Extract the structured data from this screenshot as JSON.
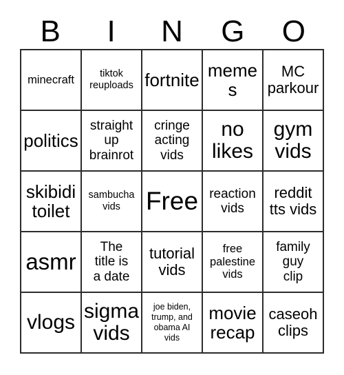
{
  "card": {
    "title_letters": [
      "B",
      "I",
      "N",
      "G",
      "O"
    ],
    "background_color": "#ffffff",
    "border_color": "#2b2b2b",
    "text_color": "#000000",
    "grid_size": "5x5",
    "free_space_label": "Free",
    "free_space_position": "row3-col3"
  },
  "rows": [
    {
      "cells": [
        {
          "text": "minecraft",
          "size": "m"
        },
        {
          "text": "tiktok\nreuploads",
          "size": "s"
        },
        {
          "text": "fortnite",
          "size": "xxl"
        },
        {
          "text": "memes",
          "size": "xxl"
        },
        {
          "text": "MC\nparkour",
          "size": "xl"
        }
      ]
    },
    {
      "cells": [
        {
          "text": "politics",
          "size": "xxl"
        },
        {
          "text": "straight\nup\nbrainrot",
          "size": "l"
        },
        {
          "text": "cringe\nacting\nvids",
          "size": "l"
        },
        {
          "text": "no\nlikes",
          "size": "3xl"
        },
        {
          "text": "gym\nvids",
          "size": "3xl"
        }
      ]
    },
    {
      "cells": [
        {
          "text": "skibidi\ntoilet",
          "size": "xxl"
        },
        {
          "text": "sambucha\nvids",
          "size": "s"
        },
        {
          "text": "Free",
          "size": "free"
        },
        {
          "text": "reaction\nvids",
          "size": "l"
        },
        {
          "text": "reddit\ntts vids",
          "size": "xl"
        }
      ]
    },
    {
      "cells": [
        {
          "text": "asmr",
          "size": "4xl"
        },
        {
          "text": "The\ntitle is\na date",
          "size": "l"
        },
        {
          "text": "tutorial\nvids",
          "size": "xl"
        },
        {
          "text": "free\npalestine\nvids",
          "size": "m"
        },
        {
          "text": "family\nguy\nclip",
          "size": "l"
        }
      ]
    },
    {
      "cells": [
        {
          "text": "vlogs",
          "size": "3xl"
        },
        {
          "text": "sigma\nvids",
          "size": "3xl"
        },
        {
          "text": "joe biden,\ntrump, and\nobama AI\nvids",
          "size": "xs"
        },
        {
          "text": "movie\nrecap",
          "size": "xxl"
        },
        {
          "text": "caseoh\nclips",
          "size": "xl"
        }
      ]
    }
  ]
}
